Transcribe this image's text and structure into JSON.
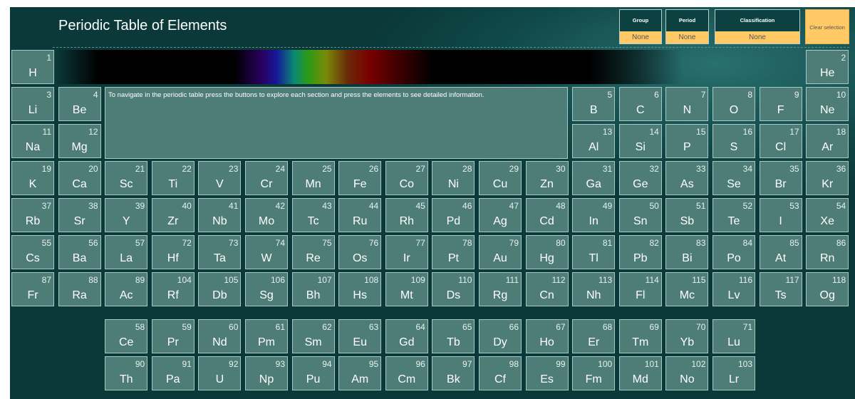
{
  "header": {
    "title": "Periodic Table of Elements",
    "group": {
      "label": "Group",
      "value": "None"
    },
    "period": {
      "label": "Period",
      "value": "None"
    },
    "classification": {
      "label": "Classification",
      "value": "None"
    },
    "clear_label": "Clear selection"
  },
  "info_text": "To navigate in the periodic table press the buttons to explore each section and press the elements to see detailed information.",
  "elements": [
    {
      "n": "1",
      "s": "H",
      "r": 1,
      "c": 1
    },
    {
      "n": "2",
      "s": "He",
      "r": 1,
      "c": 18
    },
    {
      "n": "3",
      "s": "Li",
      "r": 2,
      "c": 1
    },
    {
      "n": "4",
      "s": "Be",
      "r": 2,
      "c": 2
    },
    {
      "n": "5",
      "s": "B",
      "r": 2,
      "c": 13
    },
    {
      "n": "6",
      "s": "C",
      "r": 2,
      "c": 14
    },
    {
      "n": "7",
      "s": "N",
      "r": 2,
      "c": 15
    },
    {
      "n": "8",
      "s": "O",
      "r": 2,
      "c": 16
    },
    {
      "n": "9",
      "s": "F",
      "r": 2,
      "c": 17
    },
    {
      "n": "10",
      "s": "Ne",
      "r": 2,
      "c": 18
    },
    {
      "n": "11",
      "s": "Na",
      "r": 3,
      "c": 1
    },
    {
      "n": "12",
      "s": "Mg",
      "r": 3,
      "c": 2
    },
    {
      "n": "13",
      "s": "Al",
      "r": 3,
      "c": 13
    },
    {
      "n": "14",
      "s": "Si",
      "r": 3,
      "c": 14
    },
    {
      "n": "15",
      "s": "P",
      "r": 3,
      "c": 15
    },
    {
      "n": "16",
      "s": "S",
      "r": 3,
      "c": 16
    },
    {
      "n": "17",
      "s": "Cl",
      "r": 3,
      "c": 17
    },
    {
      "n": "18",
      "s": "Ar",
      "r": 3,
      "c": 18
    },
    {
      "n": "19",
      "s": "K",
      "r": 4,
      "c": 1
    },
    {
      "n": "20",
      "s": "Ca",
      "r": 4,
      "c": 2
    },
    {
      "n": "21",
      "s": "Sc",
      "r": 4,
      "c": 3
    },
    {
      "n": "22",
      "s": "Ti",
      "r": 4,
      "c": 4
    },
    {
      "n": "23",
      "s": "V",
      "r": 4,
      "c": 5
    },
    {
      "n": "24",
      "s": "Cr",
      "r": 4,
      "c": 6
    },
    {
      "n": "25",
      "s": "Mn",
      "r": 4,
      "c": 7
    },
    {
      "n": "26",
      "s": "Fe",
      "r": 4,
      "c": 8
    },
    {
      "n": "27",
      "s": "Co",
      "r": 4,
      "c": 9
    },
    {
      "n": "28",
      "s": "Ni",
      "r": 4,
      "c": 10
    },
    {
      "n": "29",
      "s": "Cu",
      "r": 4,
      "c": 11
    },
    {
      "n": "30",
      "s": "Zn",
      "r": 4,
      "c": 12
    },
    {
      "n": "31",
      "s": "Ga",
      "r": 4,
      "c": 13
    },
    {
      "n": "32",
      "s": "Ge",
      "r": 4,
      "c": 14
    },
    {
      "n": "33",
      "s": "As",
      "r": 4,
      "c": 15
    },
    {
      "n": "34",
      "s": "Se",
      "r": 4,
      "c": 16
    },
    {
      "n": "35",
      "s": "Br",
      "r": 4,
      "c": 17
    },
    {
      "n": "36",
      "s": "Kr",
      "r": 4,
      "c": 18
    },
    {
      "n": "37",
      "s": "Rb",
      "r": 5,
      "c": 1
    },
    {
      "n": "38",
      "s": "Sr",
      "r": 5,
      "c": 2
    },
    {
      "n": "39",
      "s": "Y",
      "r": 5,
      "c": 3
    },
    {
      "n": "40",
      "s": "Zr",
      "r": 5,
      "c": 4
    },
    {
      "n": "41",
      "s": "Nb",
      "r": 5,
      "c": 5
    },
    {
      "n": "42",
      "s": "Mo",
      "r": 5,
      "c": 6
    },
    {
      "n": "43",
      "s": "Tc",
      "r": 5,
      "c": 7
    },
    {
      "n": "44",
      "s": "Ru",
      "r": 5,
      "c": 8
    },
    {
      "n": "45",
      "s": "Rh",
      "r": 5,
      "c": 9
    },
    {
      "n": "46",
      "s": "Pd",
      "r": 5,
      "c": 10
    },
    {
      "n": "47",
      "s": "Ag",
      "r": 5,
      "c": 11
    },
    {
      "n": "48",
      "s": "Cd",
      "r": 5,
      "c": 12
    },
    {
      "n": "49",
      "s": "In",
      "r": 5,
      "c": 13
    },
    {
      "n": "50",
      "s": "Sn",
      "r": 5,
      "c": 14
    },
    {
      "n": "51",
      "s": "Sb",
      "r": 5,
      "c": 15
    },
    {
      "n": "52",
      "s": "Te",
      "r": 5,
      "c": 16
    },
    {
      "n": "53",
      "s": "I",
      "r": 5,
      "c": 17
    },
    {
      "n": "54",
      "s": "Xe",
      "r": 5,
      "c": 18
    },
    {
      "n": "55",
      "s": "Cs",
      "r": 6,
      "c": 1
    },
    {
      "n": "56",
      "s": "Ba",
      "r": 6,
      "c": 2
    },
    {
      "n": "57",
      "s": "La",
      "r": 6,
      "c": 3
    },
    {
      "n": "72",
      "s": "Hf",
      "r": 6,
      "c": 4
    },
    {
      "n": "73",
      "s": "Ta",
      "r": 6,
      "c": 5
    },
    {
      "n": "74",
      "s": "W",
      "r": 6,
      "c": 6
    },
    {
      "n": "75",
      "s": "Re",
      "r": 6,
      "c": 7
    },
    {
      "n": "76",
      "s": "Os",
      "r": 6,
      "c": 8
    },
    {
      "n": "77",
      "s": "Ir",
      "r": 6,
      "c": 9
    },
    {
      "n": "78",
      "s": "Pt",
      "r": 6,
      "c": 10
    },
    {
      "n": "79",
      "s": "Au",
      "r": 6,
      "c": 11
    },
    {
      "n": "80",
      "s": "Hg",
      "r": 6,
      "c": 12
    },
    {
      "n": "81",
      "s": "Tl",
      "r": 6,
      "c": 13
    },
    {
      "n": "82",
      "s": "Pb",
      "r": 6,
      "c": 14
    },
    {
      "n": "83",
      "s": "Bi",
      "r": 6,
      "c": 15
    },
    {
      "n": "84",
      "s": "Po",
      "r": 6,
      "c": 16
    },
    {
      "n": "85",
      "s": "At",
      "r": 6,
      "c": 17
    },
    {
      "n": "86",
      "s": "Rn",
      "r": 6,
      "c": 18
    },
    {
      "n": "87",
      "s": "Fr",
      "r": 7,
      "c": 1
    },
    {
      "n": "88",
      "s": "Ra",
      "r": 7,
      "c": 2
    },
    {
      "n": "89",
      "s": "Ac",
      "r": 7,
      "c": 3
    },
    {
      "n": "104",
      "s": "Rf",
      "r": 7,
      "c": 4
    },
    {
      "n": "105",
      "s": "Db",
      "r": 7,
      "c": 5
    },
    {
      "n": "106",
      "s": "Sg",
      "r": 7,
      "c": 6
    },
    {
      "n": "107",
      "s": "Bh",
      "r": 7,
      "c": 7
    },
    {
      "n": "108",
      "s": "Hs",
      "r": 7,
      "c": 8
    },
    {
      "n": "109",
      "s": "Mt",
      "r": 7,
      "c": 9
    },
    {
      "n": "110",
      "s": "Ds",
      "r": 7,
      "c": 10
    },
    {
      "n": "111",
      "s": "Rg",
      "r": 7,
      "c": 11
    },
    {
      "n": "112",
      "s": "Cn",
      "r": 7,
      "c": 12
    },
    {
      "n": "113",
      "s": "Nh",
      "r": 7,
      "c": 13
    },
    {
      "n": "114",
      "s": "Fl",
      "r": 7,
      "c": 14
    },
    {
      "n": "115",
      "s": "Mc",
      "r": 7,
      "c": 15
    },
    {
      "n": "116",
      "s": "Lv",
      "r": 7,
      "c": 16
    },
    {
      "n": "117",
      "s": "Ts",
      "r": 7,
      "c": 17
    },
    {
      "n": "118",
      "s": "Og",
      "r": 7,
      "c": 18
    },
    {
      "n": "58",
      "s": "Ce",
      "r": 8,
      "c": 3
    },
    {
      "n": "59",
      "s": "Pr",
      "r": 8,
      "c": 4
    },
    {
      "n": "60",
      "s": "Nd",
      "r": 8,
      "c": 5
    },
    {
      "n": "61",
      "s": "Pm",
      "r": 8,
      "c": 6
    },
    {
      "n": "62",
      "s": "Sm",
      "r": 8,
      "c": 7
    },
    {
      "n": "63",
      "s": "Eu",
      "r": 8,
      "c": 8
    },
    {
      "n": "64",
      "s": "Gd",
      "r": 8,
      "c": 9
    },
    {
      "n": "65",
      "s": "Tb",
      "r": 8,
      "c": 10
    },
    {
      "n": "66",
      "s": "Dy",
      "r": 8,
      "c": 11
    },
    {
      "n": "67",
      "s": "Ho",
      "r": 8,
      "c": 12
    },
    {
      "n": "68",
      "s": "Er",
      "r": 8,
      "c": 13
    },
    {
      "n": "69",
      "s": "Tm",
      "r": 8,
      "c": 14
    },
    {
      "n": "70",
      "s": "Yb",
      "r": 8,
      "c": 15
    },
    {
      "n": "71",
      "s": "Lu",
      "r": 8,
      "c": 16
    },
    {
      "n": "90",
      "s": "Th",
      "r": 9,
      "c": 3
    },
    {
      "n": "91",
      "s": "Pa",
      "r": 9,
      "c": 4
    },
    {
      "n": "92",
      "s": "U",
      "r": 9,
      "c": 5
    },
    {
      "n": "93",
      "s": "Np",
      "r": 9,
      "c": 6
    },
    {
      "n": "94",
      "s": "Pu",
      "r": 9,
      "c": 7
    },
    {
      "n": "95",
      "s": "Am",
      "r": 9,
      "c": 8
    },
    {
      "n": "96",
      "s": "Cm",
      "r": 9,
      "c": 9
    },
    {
      "n": "97",
      "s": "Bk",
      "r": 9,
      "c": 10
    },
    {
      "n": "98",
      "s": "Cf",
      "r": 9,
      "c": 11
    },
    {
      "n": "99",
      "s": "Es",
      "r": 9,
      "c": 12
    },
    {
      "n": "100",
      "s": "Fm",
      "r": 9,
      "c": 13
    },
    {
      "n": "101",
      "s": "Md",
      "r": 9,
      "c": 14
    },
    {
      "n": "102",
      "s": "No",
      "r": 9,
      "c": 15
    },
    {
      "n": "103",
      "s": "Lr",
      "r": 9,
      "c": 16
    }
  ]
}
